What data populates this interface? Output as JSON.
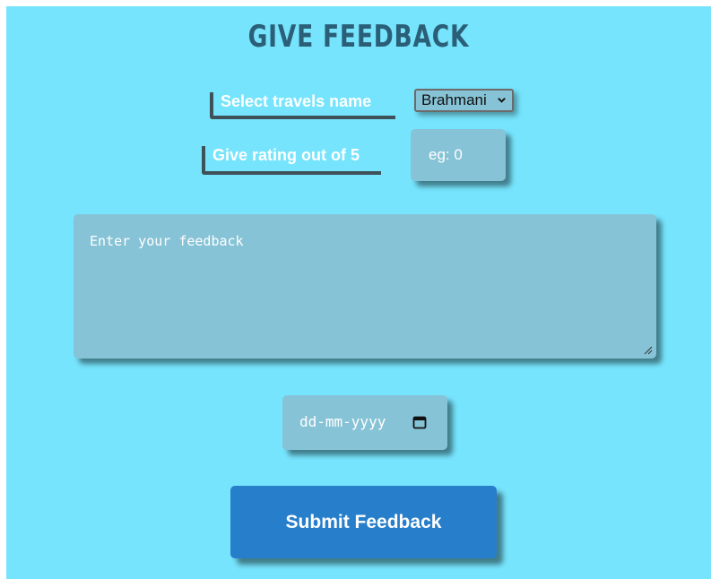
{
  "page": {
    "title": "GIVE FEEDBACK",
    "background_color": "#76e4fc"
  },
  "form": {
    "travels_label": "Select travels name",
    "travels_selected": "Brahmani",
    "rating_label": "Give rating out of 5",
    "rating_placeholder": "eg: 0",
    "feedback_placeholder": "Enter your feedback",
    "date_placeholder": "dd-mm-yyyy",
    "submit_label": "Submit Feedback"
  },
  "icons": {
    "select_chevron": "chevron-down-icon",
    "date_picker": "calendar-icon",
    "textarea_resize": "resize-handle-icon"
  },
  "colors": {
    "title": "#2b5f78",
    "input_background": "#87c3d6",
    "button_background": "#277ecb",
    "label_border": "#3e5058"
  }
}
